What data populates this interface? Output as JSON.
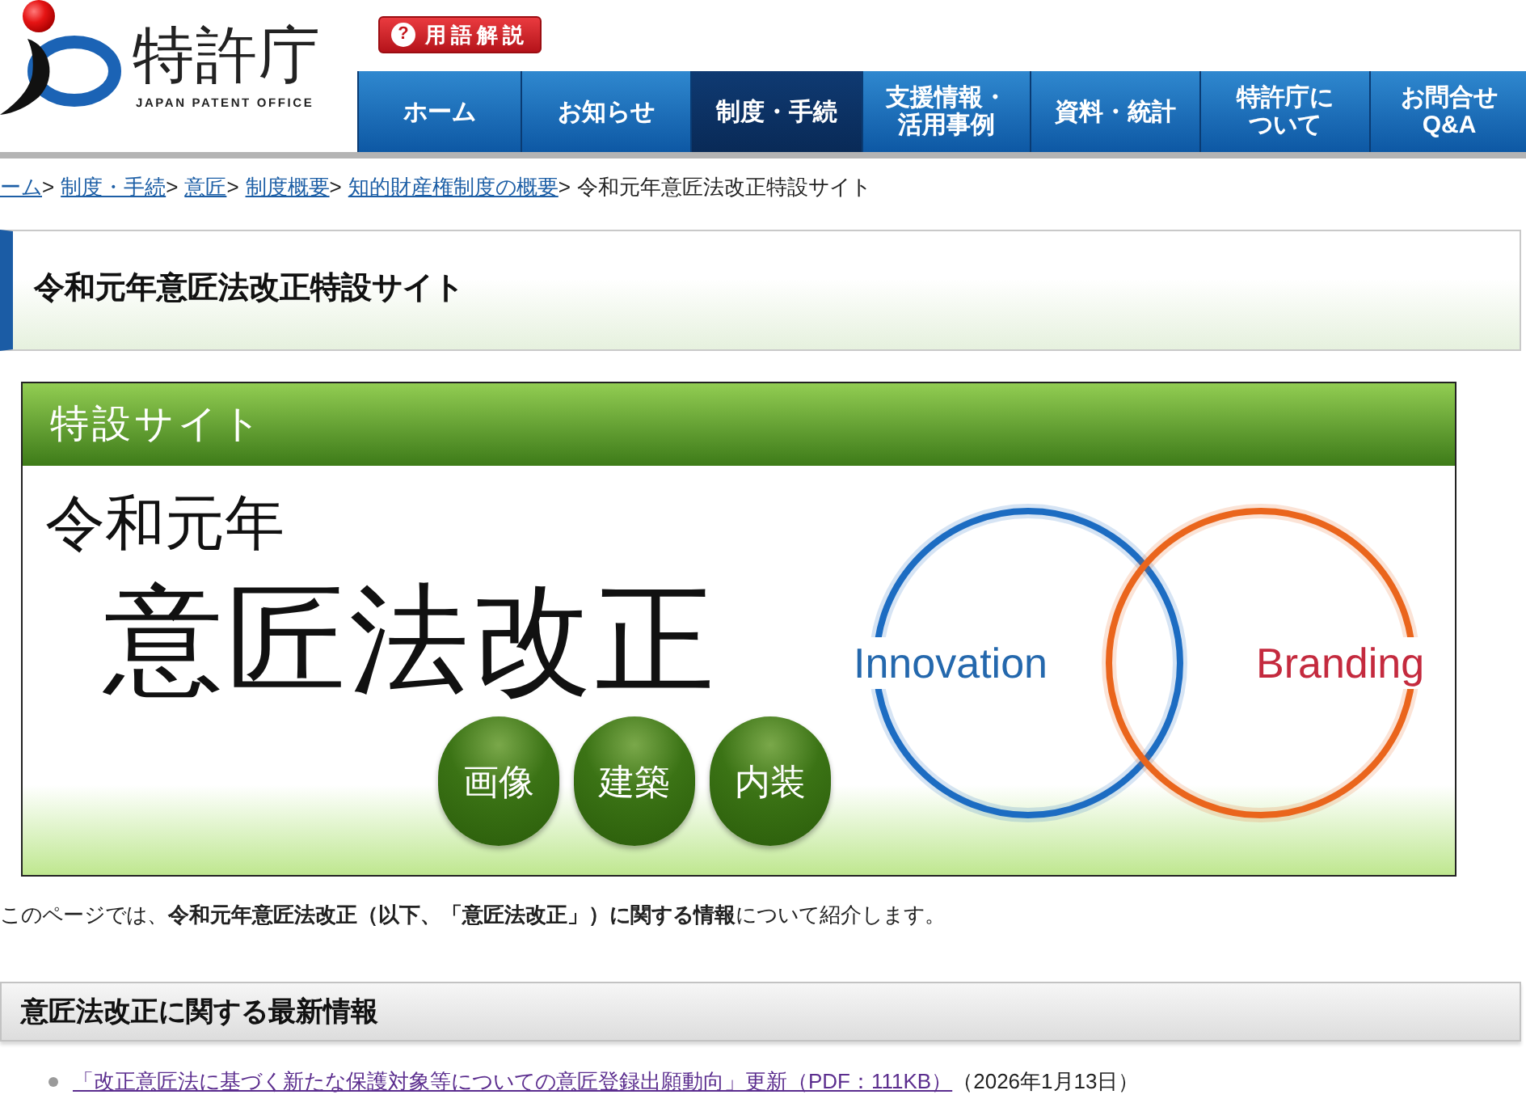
{
  "header": {
    "logo": {
      "title": "特許庁",
      "subtitle": "JAPAN PATENT OFFICE"
    },
    "glossary_button": {
      "icon": "?",
      "label": "用語解説"
    }
  },
  "nav": [
    {
      "lines": [
        "ホーム"
      ],
      "selected": false
    },
    {
      "lines": [
        "お知らせ"
      ],
      "selected": false
    },
    {
      "lines": [
        "制度・手続"
      ],
      "selected": true
    },
    {
      "lines": [
        "支援情報・",
        "活用事例"
      ],
      "selected": false
    },
    {
      "lines": [
        "資料・統計"
      ],
      "selected": false
    },
    {
      "lines": [
        "特許庁に",
        "ついて"
      ],
      "selected": false
    },
    {
      "lines": [
        "お問合せ",
        "Q&A"
      ],
      "selected": false
    }
  ],
  "breadcrumb": [
    {
      "kind": "link",
      "label": "ーム",
      "separator": ">"
    },
    {
      "kind": "link",
      "label": "制度・手続",
      "separator": ">"
    },
    {
      "kind": "link",
      "label": "意匠",
      "separator": ">"
    },
    {
      "kind": "link",
      "label": "制度概要",
      "separator": ">"
    },
    {
      "kind": "link",
      "label": "知的財産権制度の概要",
      "separator": ">"
    },
    {
      "kind": "current",
      "label": "令和元年意匠法改正特設サイト"
    }
  ],
  "page_title": "令和元年意匠法改正特設サイト",
  "banner": {
    "header": "特設サイト",
    "year": "令和元年",
    "headline": "意匠法改正",
    "topics": [
      "画像",
      "建築",
      "内装"
    ],
    "venn": [
      {
        "color": "#1c6cc2",
        "label": {
          "text": "Innovation",
          "color": "#2468ad"
        }
      },
      {
        "color": "#ea651c",
        "label": {
          "text": "Branding",
          "color": "#c42a3e"
        }
      }
    ]
  },
  "intro": "このページでは、**令和元年意匠法改正（以下、「意匠法改正」）に関する情報**について紹介します。",
  "latest_news": {
    "heading": "意匠法改正に関する最新情報",
    "items": [
      {
        "link": "「改正意匠法に基づく新たな保護対象等についての意匠登録出願動向」更新（PDF：111KB）",
        "date": "（2026年1月13日）"
      }
    ]
  }
}
